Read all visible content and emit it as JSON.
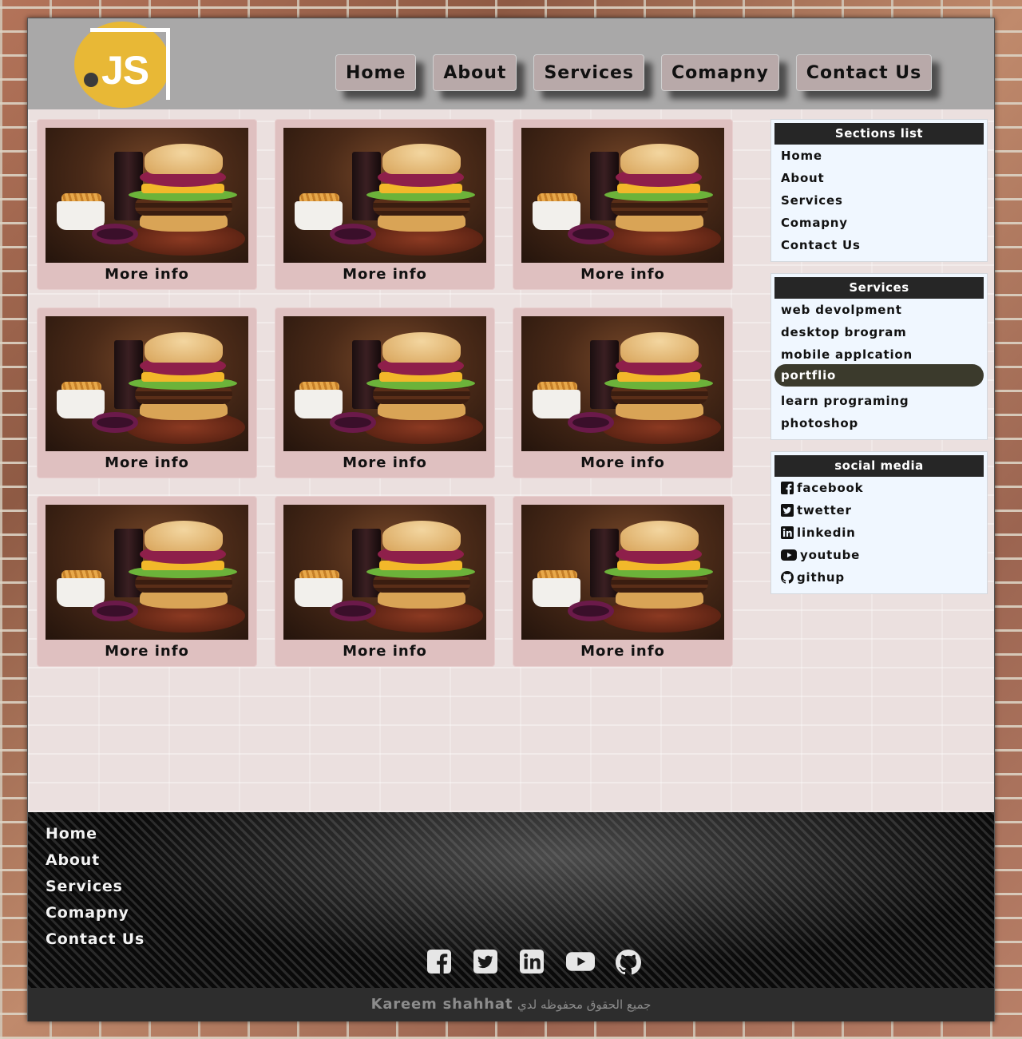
{
  "logo": {
    "text": "JS"
  },
  "nav": {
    "items": [
      "Home",
      "About",
      "Services",
      "Comapny",
      "Contact Us"
    ]
  },
  "cards": [
    {
      "label": "More info"
    },
    {
      "label": "More info"
    },
    {
      "label": "More info"
    },
    {
      "label": "More info"
    },
    {
      "label": "More info"
    },
    {
      "label": "More info"
    },
    {
      "label": "More info"
    },
    {
      "label": "More info"
    },
    {
      "label": "More info"
    }
  ],
  "sidebar": {
    "sections": {
      "title": "Sections list",
      "items": [
        "Home",
        "About",
        "Services",
        "Comapny",
        "Contact Us"
      ]
    },
    "services": {
      "title": "Services",
      "items": [
        "web devolpment",
        "desktop brogram",
        "mobile applcation",
        "portflio",
        "learn programing",
        "photoshop"
      ],
      "active_index": 3
    },
    "social": {
      "title": "social media",
      "items": [
        {
          "label": "facebook",
          "icon": "facebook-icon"
        },
        {
          "label": "twetter",
          "icon": "twitter-icon"
        },
        {
          "label": "linkedin",
          "icon": "linkedin-icon"
        },
        {
          "label": "youtube",
          "icon": "youtube-icon"
        },
        {
          "label": "githup",
          "icon": "github-icon"
        }
      ]
    }
  },
  "footer": {
    "links": [
      "Home",
      "About",
      "Services",
      "Comapny",
      "Contact Us"
    ],
    "social_icons": [
      "facebook-icon",
      "twitter-icon",
      "linkedin-icon",
      "youtube-icon",
      "github-icon"
    ],
    "copyright_name": "Kareem shahhat",
    "copyright_text": "جميع الحقوق محفوظه لدي"
  },
  "colors": {
    "header_bg": "#a9a8a8",
    "nav_button_bg": "#b8a9a9",
    "card_bg": "#dfc0c0",
    "logo_yellow": "#e8b836",
    "panel_title_bg": "#262626",
    "panel_active_bg": "#3b3a2c",
    "copyright_bg": "#2d2d2d"
  }
}
